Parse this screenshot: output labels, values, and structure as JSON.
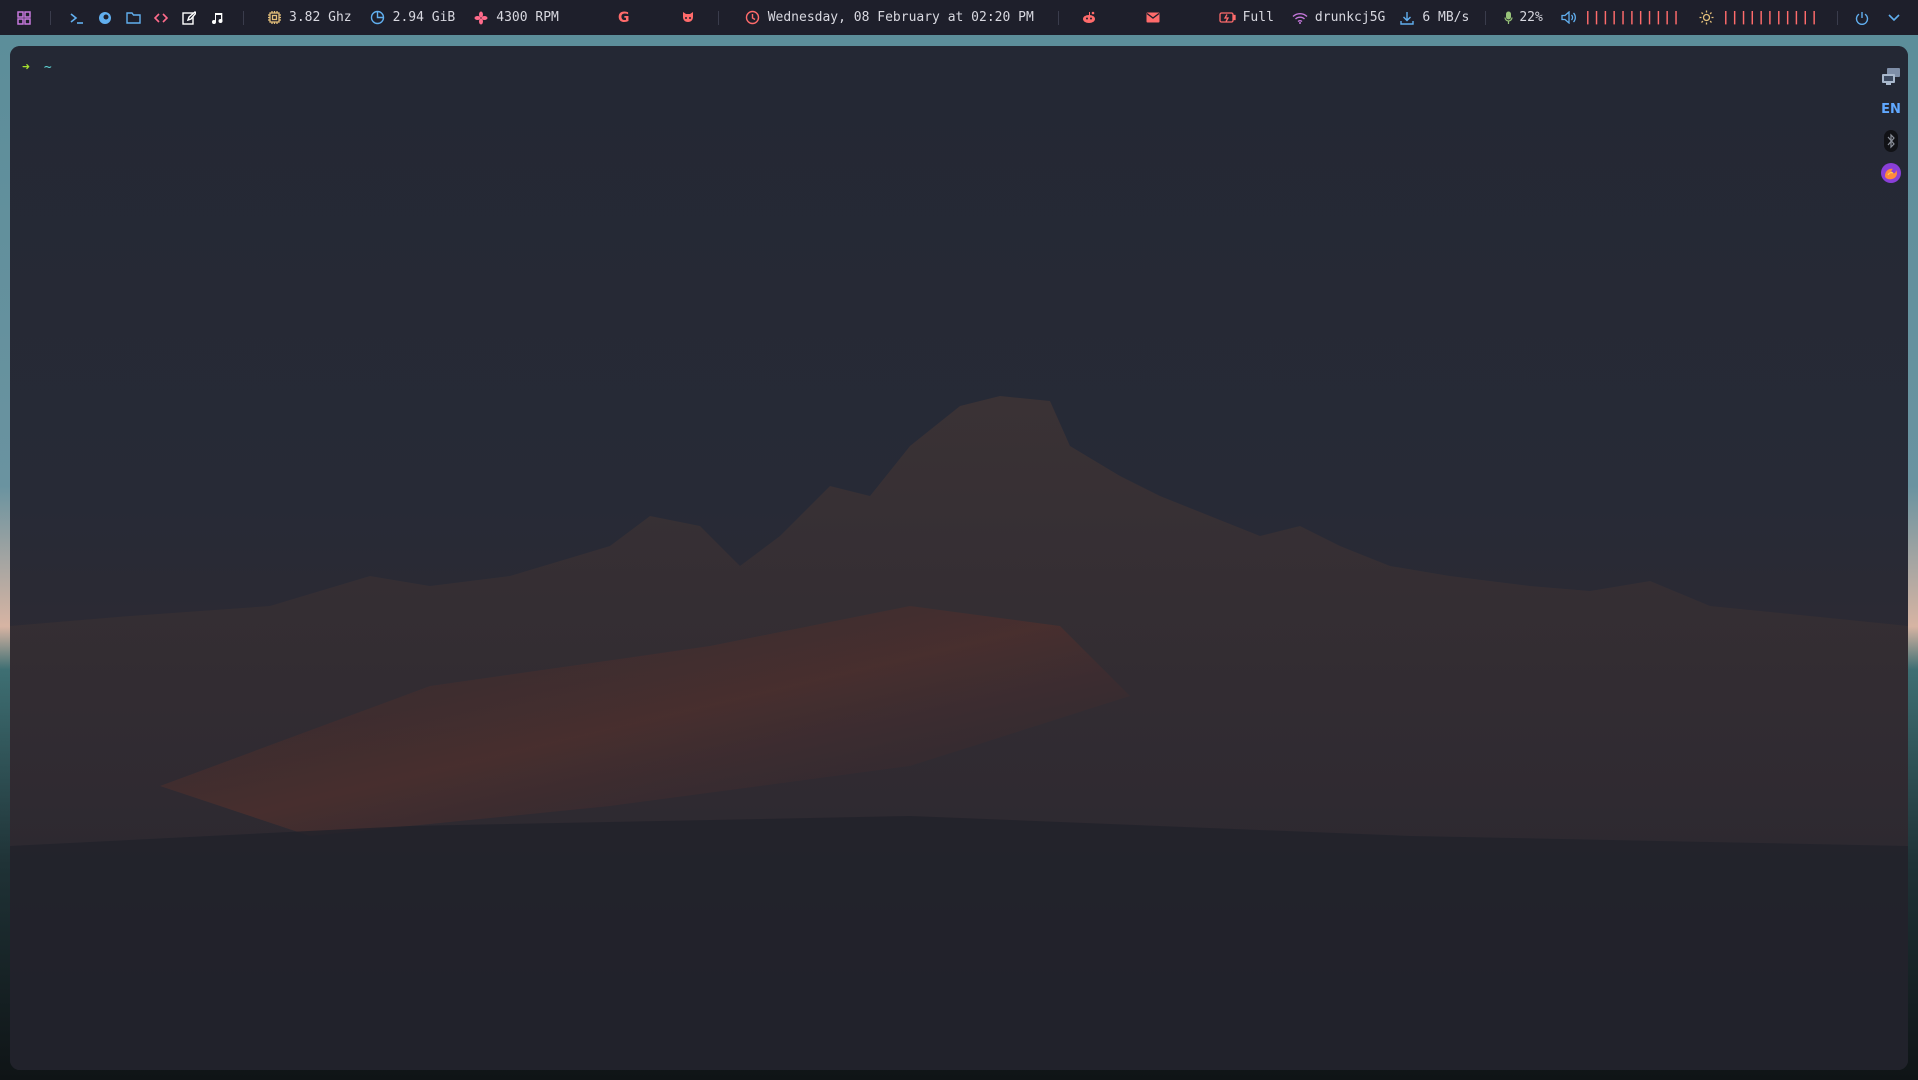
{
  "topbar": {
    "launchers": [
      {
        "icon": "grid-icon",
        "color": "#c678dd"
      },
      {
        "icon": "terminal-icon",
        "color": "#61afef"
      },
      {
        "icon": "browser-icon",
        "color": "#61afef"
      },
      {
        "icon": "folder-icon",
        "color": "#61afef"
      },
      {
        "icon": "code-icon",
        "color": "#ff6b8b"
      },
      {
        "icon": "edit-icon",
        "color": "#ffffff"
      },
      {
        "icon": "music-icon",
        "color": "#ffffff"
      }
    ],
    "cpu": {
      "icon": "cpu-icon",
      "value": "3.82 Ghz",
      "color": "#e5c07b"
    },
    "memory": {
      "icon": "memory-icon",
      "value": "2.94 GiB",
      "color": "#61afef"
    },
    "fan": {
      "icon": "fan-icon",
      "value": "4300 RPM",
      "color": "#ff6b8b"
    },
    "center_apps": [
      {
        "icon": "google-icon",
        "label": "G",
        "color": "#ff6b6b"
      },
      {
        "icon": "github-icon",
        "color": "#ff6b6b"
      }
    ],
    "clock": {
      "icon": "clock-icon",
      "value": "Wednesday, 08 February at 02:20 PM",
      "color": "#ff6b6b"
    },
    "right_apps": [
      {
        "icon": "reddit-icon",
        "color": "#ff6b6b"
      },
      {
        "icon": "mail-icon",
        "color": "#ff6b6b"
      }
    ],
    "battery": {
      "icon": "battery-icon",
      "value": "Full",
      "color": "#ff6b6b"
    },
    "wifi": {
      "icon": "wifi-icon",
      "value": "drunkcj5G",
      "color": "#c678dd"
    },
    "download": {
      "icon": "download-icon",
      "value": "6 MB/s",
      "color": "#61afef"
    },
    "mic": {
      "icon": "mic-icon",
      "value": "22%",
      "color": "#98c379"
    },
    "volume": {
      "icon": "volume-icon",
      "bars": "|||||||||||",
      "color": "#61afef"
    },
    "brightness": {
      "icon": "sun-icon",
      "bars": "|||||||||||",
      "color": "#e5c07b"
    },
    "power": {
      "icon": "power-icon",
      "color": "#61afef"
    },
    "chevron": {
      "icon": "chevron-down-icon",
      "color": "#61afef"
    }
  },
  "terminal": {
    "prompt_arrow": "➜",
    "prompt_path": "~"
  },
  "tray": {
    "items": [
      {
        "icon": "network-icon"
      },
      {
        "icon": "language-icon",
        "label": "EN"
      },
      {
        "icon": "bluetooth-icon"
      },
      {
        "icon": "firefox-icon"
      }
    ]
  }
}
